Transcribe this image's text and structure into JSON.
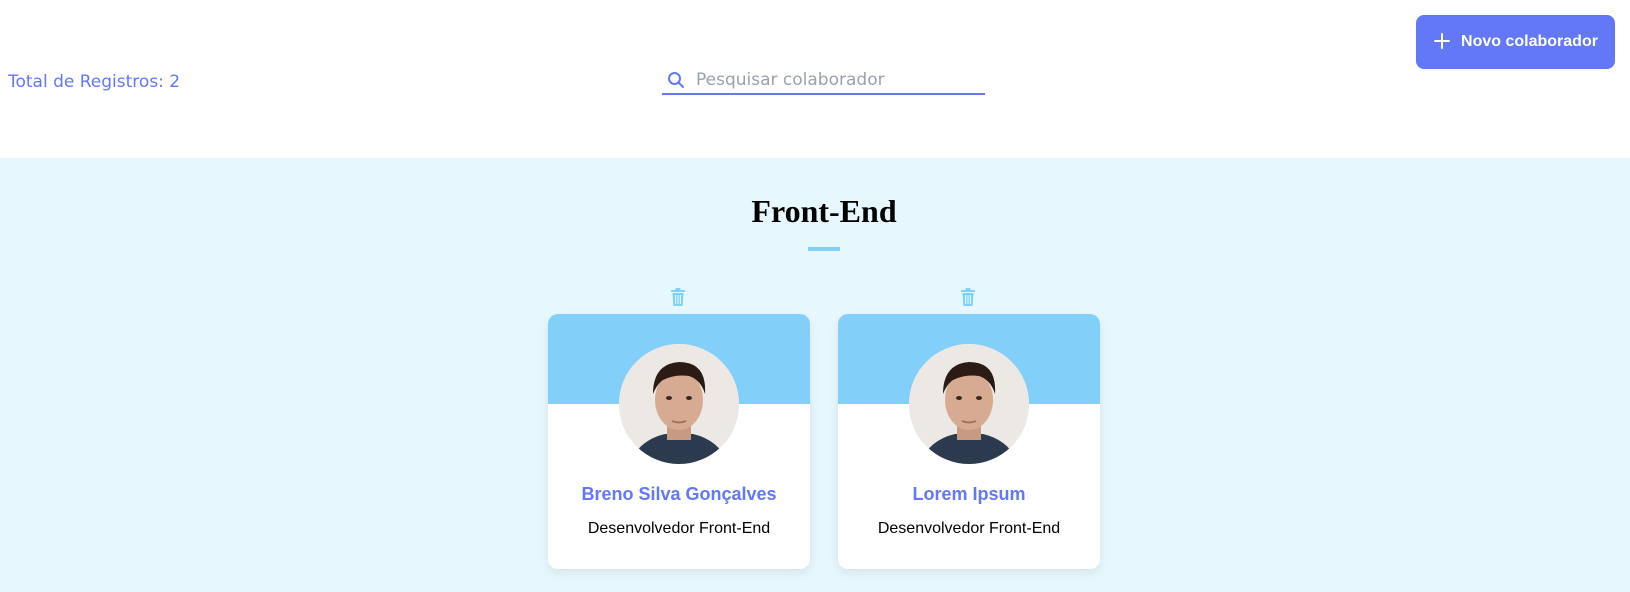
{
  "header": {
    "total_label": "Total de Registros: 2",
    "search": {
      "placeholder": "Pesquisar colaborador",
      "value": "",
      "icon": "search-icon"
    },
    "new_button": {
      "icon": "plus-icon",
      "label": "Novo colaborador"
    }
  },
  "colors": {
    "accent": "#6278f7",
    "team_primary": "#82cffa",
    "team_background": "#e6f8fd"
  },
  "team": {
    "name": "Front-End",
    "members": [
      {
        "name": "Breno Silva Gonçalves",
        "role": "Desenvolvedor Front-End",
        "delete_icon": "trash-icon"
      },
      {
        "name": "Lorem Ipsum",
        "role": "Desenvolvedor Front-End",
        "delete_icon": "trash-icon"
      }
    ]
  }
}
